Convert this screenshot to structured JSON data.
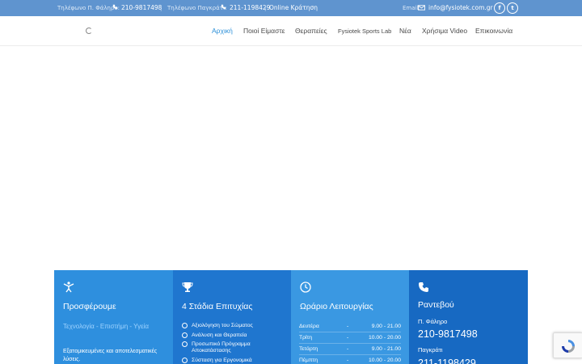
{
  "topbar": {
    "phone1_label": "Τηλέφωνο Π. Φάληρο:",
    "phone1_number": "210-9817498",
    "separator": "|",
    "phone2_label": "Τηλέφωνο Παγκράτι:",
    "phone2_number": "211-1198429",
    "separator2": "|",
    "online_booking": "Online Κράτηση",
    "email_label": "Email:",
    "email": "info@fysiotek.com.gr",
    "facebook_glyph": "f",
    "twitter_glyph": "t"
  },
  "nav": {
    "items": [
      {
        "label": "Αρχική",
        "active": true
      },
      {
        "label": "Ποιοί Είμαστε"
      },
      {
        "label": "Θεραπείες"
      },
      {
        "label": "Fysiotek Sports Lab"
      },
      {
        "label": "Νέα"
      },
      {
        "label": "Χρήσιμα Video"
      },
      {
        "label": "Επικοινωνία"
      }
    ]
  },
  "boxes": {
    "offer": {
      "icon": "person-stretch-icon",
      "title": "Προσφέρουμε",
      "subtitle": "Τεχνολογία - Επιστήμη - Υγεία",
      "description": "Εξατομικευμένες και αποτελεσματικές λύσεις."
    },
    "stages": {
      "icon": "trophy-icon",
      "title": "4 Στάδια Επιτυχίας",
      "steps": [
        "Αξιολόγηση του Σώματος",
        "Ανάλυση και Θεραπεία",
        "Προσωπικό Πρόγραμμα Αποκατάστασης",
        "Σύσταση για Εργονομικά"
      ]
    },
    "hours": {
      "icon": "clock-icon",
      "title": "Ωράριο Λειτουργίας",
      "rows": [
        {
          "day": "Δευτέρα",
          "dash": "-",
          "time": "9.00 - 21.00"
        },
        {
          "day": "Τρίτη",
          "dash": "-",
          "time": "10.00 - 20.00"
        },
        {
          "day": "Τετάρτη",
          "dash": "-",
          "time": "9.00 - 21.00"
        },
        {
          "day": "Πέμπτη",
          "dash": "-",
          "time": "10.00 - 20.00"
        }
      ]
    },
    "appointment": {
      "icon": "phone-icon",
      "title": "Ραντεβού",
      "loc1": "Π. Φάληρο",
      "num1": "210-9817498",
      "loc2": "Παγκράτι",
      "num2": "211-1198429"
    }
  },
  "colors": {
    "topbar": "#5f94cf",
    "nav_active": "#2a8fd8",
    "box1": "#2e8fde",
    "box2": "#1f76cf",
    "box3": "#3a98e2",
    "box4": "#1769c2"
  }
}
